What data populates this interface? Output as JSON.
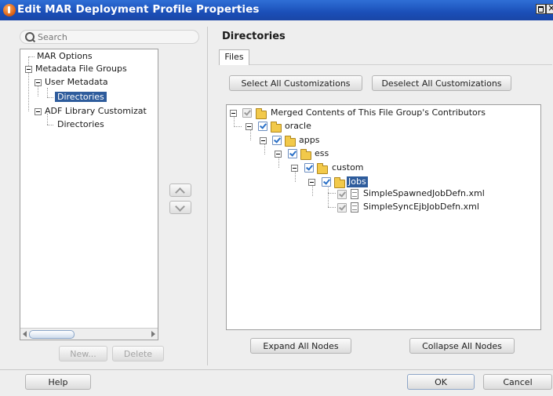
{
  "window": {
    "title": "Edit MAR Deployment Profile Properties"
  },
  "search": {
    "placeholder": "Search"
  },
  "nav_tree": [
    {
      "label": "MAR Options"
    },
    {
      "label": "Metadata File Groups"
    },
    {
      "label": "User Metadata"
    },
    {
      "label": "Directories",
      "selected": true
    },
    {
      "label": "ADF Library Customizat"
    },
    {
      "label": "Directories"
    }
  ],
  "left_buttons": {
    "new": "New...",
    "delete": "Delete"
  },
  "panel": {
    "title": "Directories",
    "tab": "Files",
    "select_all": "Select All Customizations",
    "deselect_all": "Deselect All Customizations",
    "expand_all": "Expand All Nodes",
    "collapse_all": "Collapse All Nodes"
  },
  "file_tree": [
    {
      "label": "Merged Contents of This File Group's Contributors",
      "icon": "folder-icon",
      "checked": true,
      "partial": true
    },
    {
      "label": "oracle",
      "icon": "folder-icon",
      "checked": true
    },
    {
      "label": "apps",
      "icon": "folder-icon",
      "checked": true
    },
    {
      "label": "ess",
      "icon": "folder-icon",
      "checked": true
    },
    {
      "label": "custom",
      "icon": "folder-icon",
      "checked": true
    },
    {
      "label": "Jobs",
      "icon": "folder-icon",
      "checked": true,
      "selected": true
    },
    {
      "label": "SimpleSpawnedJobDefn.xml",
      "icon": "file-icon",
      "checked": true,
      "partial": true
    },
    {
      "label": "SimpleSyncEjbJobDefn.xml",
      "icon": "file-icon",
      "checked": true,
      "partial": true
    }
  ],
  "footer": {
    "help": "Help",
    "ok": "OK",
    "cancel": "Cancel"
  },
  "colors": {
    "titlebar": "#1b4fb8",
    "selection": "#2e5c9c",
    "folder": "#f2c94a",
    "check": "#2a70c8"
  }
}
